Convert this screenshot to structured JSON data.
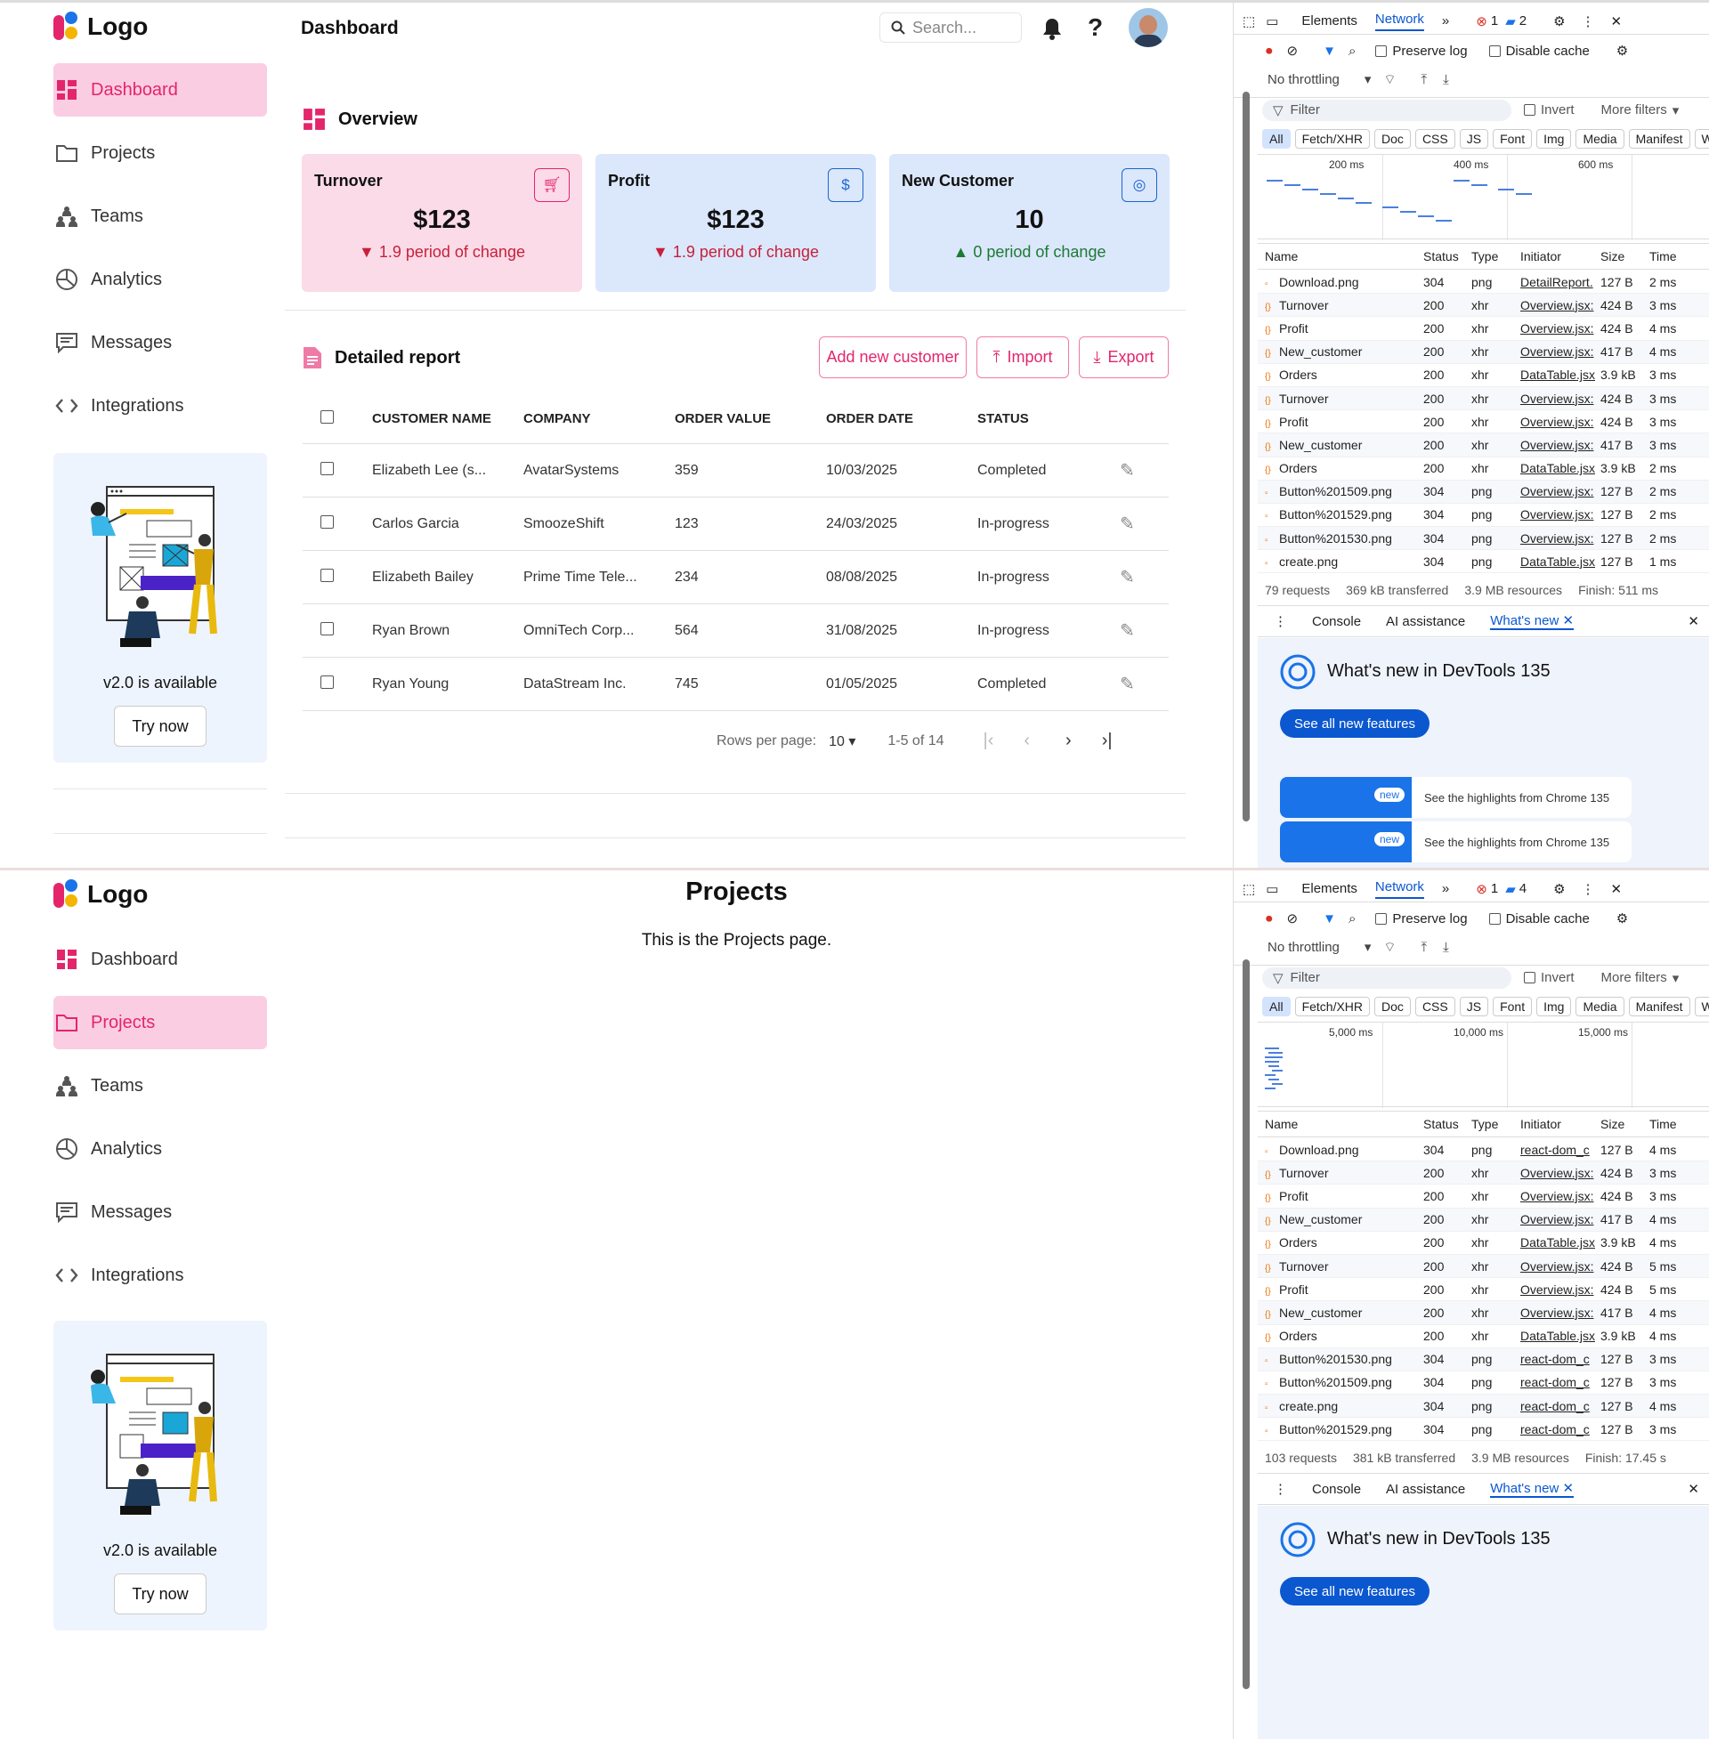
{
  "app": {
    "logo_text": "Logo",
    "nav": [
      {
        "label": "Dashboard",
        "icon": "dashboard-icon"
      },
      {
        "label": "Projects",
        "icon": "folder-icon"
      },
      {
        "label": "Teams",
        "icon": "teams-icon"
      },
      {
        "label": "Analytics",
        "icon": "analytics-icon"
      },
      {
        "label": "Messages",
        "icon": "messages-icon"
      },
      {
        "label": "Integrations",
        "icon": "code-icon"
      }
    ],
    "promo": {
      "text": "v2.0 is available",
      "button": "Try now"
    },
    "accent": "#e3256b"
  },
  "dashboard": {
    "title": "Dashboard",
    "search_placeholder": "Search...",
    "overview_title": "Overview",
    "cards": [
      {
        "title": "Turnover",
        "value": "$123",
        "change": "▼ 1.9 period of change",
        "icon": "cart-icon",
        "bg": "#fbdbe8",
        "fg": "#e3256b"
      },
      {
        "title": "Profit",
        "value": "$123",
        "change": "▼ 1.9 period of change",
        "icon": "dollar-icon",
        "bg": "#dbe7fb",
        "fg": "#1a66d2"
      },
      {
        "title": "New Customer",
        "value": "10",
        "change": "▲ 0 period of change",
        "icon": "user-icon",
        "bg": "#dbe7fb",
        "fg": "#1a66d2"
      }
    ],
    "report_title": "Detailed report",
    "buttons": {
      "add": "Add new customer",
      "import": "Import",
      "export": "Export"
    },
    "columns": [
      "CUSTOMER NAME",
      "COMPANY",
      "ORDER VALUE",
      "ORDER DATE",
      "STATUS"
    ],
    "rows": [
      {
        "name": "Elizabeth Lee (s...",
        "company": "AvatarSystems",
        "value": "359",
        "date": "10/03/2025",
        "status": "Completed"
      },
      {
        "name": "Carlos Garcia",
        "company": "SmoozeShift",
        "value": "123",
        "date": "24/03/2025",
        "status": "In-progress"
      },
      {
        "name": "Elizabeth Bailey",
        "company": "Prime Time Tele...",
        "value": "234",
        "date": "08/08/2025",
        "status": "In-progress"
      },
      {
        "name": "Ryan Brown",
        "company": "OmniTech Corp...",
        "value": "564",
        "date": "31/08/2025",
        "status": "In-progress"
      },
      {
        "name": "Ryan Young",
        "company": "DataStream Inc.",
        "value": "745",
        "date": "01/05/2025",
        "status": "Completed"
      }
    ],
    "pager": {
      "rows_label": "Rows per page:",
      "rows_value": "10",
      "range": "1-5 of 14"
    }
  },
  "projects": {
    "title": "Projects",
    "text": "This is the Projects page."
  },
  "devtools": [
    {
      "tabs": [
        "Elements",
        "Network"
      ],
      "errors": "1",
      "messages": "2",
      "preserve_log": "Preserve log",
      "disable_cache": "Disable cache",
      "throttling": "No throttling",
      "filter_placeholder": "Filter",
      "invert": "Invert",
      "more_filters": "More filters",
      "chips": [
        "All",
        "Fetch/XHR",
        "Doc",
        "CSS",
        "JS",
        "Font",
        "Img",
        "Media",
        "Manifest",
        "WS"
      ],
      "timeline": [
        "200 ms",
        "400 ms",
        "600 ms"
      ],
      "headers": [
        "Name",
        "Status",
        "Type",
        "Initiator",
        "Size",
        "Time"
      ],
      "rows": [
        [
          "Download.png",
          "304",
          "png",
          "DetailReport.",
          "127 B",
          "2 ms"
        ],
        [
          "Turnover",
          "200",
          "xhr",
          "Overview.jsx:",
          "424 B",
          "3 ms"
        ],
        [
          "Profit",
          "200",
          "xhr",
          "Overview.jsx:",
          "424 B",
          "4 ms"
        ],
        [
          "New_customer",
          "200",
          "xhr",
          "Overview.jsx:",
          "417 B",
          "4 ms"
        ],
        [
          "Orders",
          "200",
          "xhr",
          "DataTable.jsx",
          "3.9 kB",
          "3 ms"
        ],
        [
          "Turnover",
          "200",
          "xhr",
          "Overview.jsx:",
          "424 B",
          "3 ms"
        ],
        [
          "Profit",
          "200",
          "xhr",
          "Overview.jsx:",
          "424 B",
          "3 ms"
        ],
        [
          "New_customer",
          "200",
          "xhr",
          "Overview.jsx:",
          "417 B",
          "3 ms"
        ],
        [
          "Orders",
          "200",
          "xhr",
          "DataTable.jsx",
          "3.9 kB",
          "2 ms"
        ],
        [
          "Button%201509.png",
          "304",
          "png",
          "Overview.jsx:",
          "127 B",
          "2 ms"
        ],
        [
          "Button%201529.png",
          "304",
          "png",
          "Overview.jsx:",
          "127 B",
          "2 ms"
        ],
        [
          "Button%201530.png",
          "304",
          "png",
          "Overview.jsx:",
          "127 B",
          "2 ms"
        ],
        [
          "create.png",
          "304",
          "png",
          "DataTable.jsx",
          "127 B",
          "1 ms"
        ]
      ],
      "summary": [
        "79 requests",
        "369 kB transferred",
        "3.9 MB resources",
        "Finish: 511 ms"
      ],
      "drawer_tabs": [
        "Console",
        "AI assistance",
        "What's new"
      ],
      "whats_new_title": "What's new in DevTools 135",
      "see_all": "See all new features",
      "highlight": "See the highlights from Chrome 135",
      "badge": "new"
    },
    {
      "tabs": [
        "Elements",
        "Network"
      ],
      "errors": "1",
      "messages": "4",
      "preserve_log": "Preserve log",
      "disable_cache": "Disable cache",
      "throttling": "No throttling",
      "filter_placeholder": "Filter",
      "invert": "Invert",
      "more_filters": "More filters",
      "chips": [
        "All",
        "Fetch/XHR",
        "Doc",
        "CSS",
        "JS",
        "Font",
        "Img",
        "Media",
        "Manifest",
        "WS"
      ],
      "timeline": [
        "5,000 ms",
        "10,000 ms",
        "15,000 ms"
      ],
      "headers": [
        "Name",
        "Status",
        "Type",
        "Initiator",
        "Size",
        "Time"
      ],
      "rows": [
        [
          "Download.png",
          "304",
          "png",
          "react-dom_c",
          "127 B",
          "4 ms"
        ],
        [
          "Turnover",
          "200",
          "xhr",
          "Overview.jsx:",
          "424 B",
          "3 ms"
        ],
        [
          "Profit",
          "200",
          "xhr",
          "Overview.jsx:",
          "424 B",
          "3 ms"
        ],
        [
          "New_customer",
          "200",
          "xhr",
          "Overview.jsx:",
          "417 B",
          "4 ms"
        ],
        [
          "Orders",
          "200",
          "xhr",
          "DataTable.jsx",
          "3.9 kB",
          "4 ms"
        ],
        [
          "Turnover",
          "200",
          "xhr",
          "Overview.jsx:",
          "424 B",
          "5 ms"
        ],
        [
          "Profit",
          "200",
          "xhr",
          "Overview.jsx:",
          "424 B",
          "5 ms"
        ],
        [
          "New_customer",
          "200",
          "xhr",
          "Overview.jsx:",
          "417 B",
          "4 ms"
        ],
        [
          "Orders",
          "200",
          "xhr",
          "DataTable.jsx",
          "3.9 kB",
          "4 ms"
        ],
        [
          "Button%201530.png",
          "304",
          "png",
          "react-dom_c",
          "127 B",
          "3 ms"
        ],
        [
          "Button%201509.png",
          "304",
          "png",
          "react-dom_c",
          "127 B",
          "3 ms"
        ],
        [
          "create.png",
          "304",
          "png",
          "react-dom_c",
          "127 B",
          "4 ms"
        ],
        [
          "Button%201529.png",
          "304",
          "png",
          "react-dom_c",
          "127 B",
          "3 ms"
        ]
      ],
      "summary": [
        "103 requests",
        "381 kB transferred",
        "3.9 MB resources",
        "Finish: 17.45 s"
      ],
      "drawer_tabs": [
        "Console",
        "AI assistance",
        "What's new"
      ],
      "whats_new_title": "What's new in DevTools 135",
      "see_all": "See all new features"
    }
  ]
}
